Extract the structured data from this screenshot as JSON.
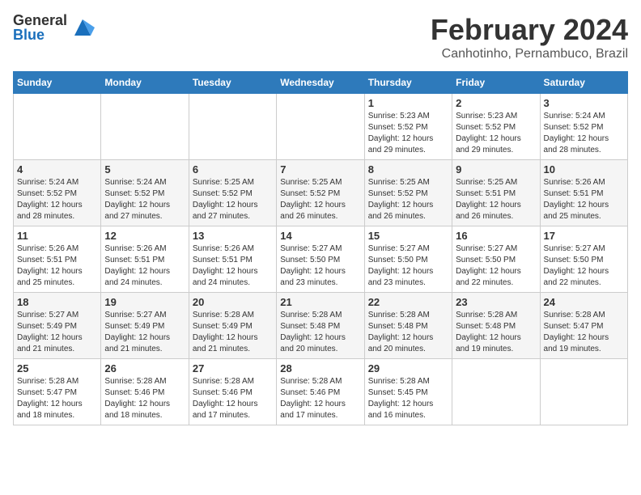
{
  "header": {
    "logo_general": "General",
    "logo_blue": "Blue",
    "month_year": "February 2024",
    "location": "Canhotinho, Pernambuco, Brazil"
  },
  "weekdays": [
    "Sunday",
    "Monday",
    "Tuesday",
    "Wednesday",
    "Thursday",
    "Friday",
    "Saturday"
  ],
  "weeks": [
    [
      {
        "day": "",
        "info": ""
      },
      {
        "day": "",
        "info": ""
      },
      {
        "day": "",
        "info": ""
      },
      {
        "day": "",
        "info": ""
      },
      {
        "day": "1",
        "info": "Sunrise: 5:23 AM\nSunset: 5:52 PM\nDaylight: 12 hours\nand 29 minutes."
      },
      {
        "day": "2",
        "info": "Sunrise: 5:23 AM\nSunset: 5:52 PM\nDaylight: 12 hours\nand 29 minutes."
      },
      {
        "day": "3",
        "info": "Sunrise: 5:24 AM\nSunset: 5:52 PM\nDaylight: 12 hours\nand 28 minutes."
      }
    ],
    [
      {
        "day": "4",
        "info": "Sunrise: 5:24 AM\nSunset: 5:52 PM\nDaylight: 12 hours\nand 28 minutes."
      },
      {
        "day": "5",
        "info": "Sunrise: 5:24 AM\nSunset: 5:52 PM\nDaylight: 12 hours\nand 27 minutes."
      },
      {
        "day": "6",
        "info": "Sunrise: 5:25 AM\nSunset: 5:52 PM\nDaylight: 12 hours\nand 27 minutes."
      },
      {
        "day": "7",
        "info": "Sunrise: 5:25 AM\nSunset: 5:52 PM\nDaylight: 12 hours\nand 26 minutes."
      },
      {
        "day": "8",
        "info": "Sunrise: 5:25 AM\nSunset: 5:52 PM\nDaylight: 12 hours\nand 26 minutes."
      },
      {
        "day": "9",
        "info": "Sunrise: 5:25 AM\nSunset: 5:51 PM\nDaylight: 12 hours\nand 26 minutes."
      },
      {
        "day": "10",
        "info": "Sunrise: 5:26 AM\nSunset: 5:51 PM\nDaylight: 12 hours\nand 25 minutes."
      }
    ],
    [
      {
        "day": "11",
        "info": "Sunrise: 5:26 AM\nSunset: 5:51 PM\nDaylight: 12 hours\nand 25 minutes."
      },
      {
        "day": "12",
        "info": "Sunrise: 5:26 AM\nSunset: 5:51 PM\nDaylight: 12 hours\nand 24 minutes."
      },
      {
        "day": "13",
        "info": "Sunrise: 5:26 AM\nSunset: 5:51 PM\nDaylight: 12 hours\nand 24 minutes."
      },
      {
        "day": "14",
        "info": "Sunrise: 5:27 AM\nSunset: 5:50 PM\nDaylight: 12 hours\nand 23 minutes."
      },
      {
        "day": "15",
        "info": "Sunrise: 5:27 AM\nSunset: 5:50 PM\nDaylight: 12 hours\nand 23 minutes."
      },
      {
        "day": "16",
        "info": "Sunrise: 5:27 AM\nSunset: 5:50 PM\nDaylight: 12 hours\nand 22 minutes."
      },
      {
        "day": "17",
        "info": "Sunrise: 5:27 AM\nSunset: 5:50 PM\nDaylight: 12 hours\nand 22 minutes."
      }
    ],
    [
      {
        "day": "18",
        "info": "Sunrise: 5:27 AM\nSunset: 5:49 PM\nDaylight: 12 hours\nand 21 minutes."
      },
      {
        "day": "19",
        "info": "Sunrise: 5:27 AM\nSunset: 5:49 PM\nDaylight: 12 hours\nand 21 minutes."
      },
      {
        "day": "20",
        "info": "Sunrise: 5:28 AM\nSunset: 5:49 PM\nDaylight: 12 hours\nand 21 minutes."
      },
      {
        "day": "21",
        "info": "Sunrise: 5:28 AM\nSunset: 5:48 PM\nDaylight: 12 hours\nand 20 minutes."
      },
      {
        "day": "22",
        "info": "Sunrise: 5:28 AM\nSunset: 5:48 PM\nDaylight: 12 hours\nand 20 minutes."
      },
      {
        "day": "23",
        "info": "Sunrise: 5:28 AM\nSunset: 5:48 PM\nDaylight: 12 hours\nand 19 minutes."
      },
      {
        "day": "24",
        "info": "Sunrise: 5:28 AM\nSunset: 5:47 PM\nDaylight: 12 hours\nand 19 minutes."
      }
    ],
    [
      {
        "day": "25",
        "info": "Sunrise: 5:28 AM\nSunset: 5:47 PM\nDaylight: 12 hours\nand 18 minutes."
      },
      {
        "day": "26",
        "info": "Sunrise: 5:28 AM\nSunset: 5:46 PM\nDaylight: 12 hours\nand 18 minutes."
      },
      {
        "day": "27",
        "info": "Sunrise: 5:28 AM\nSunset: 5:46 PM\nDaylight: 12 hours\nand 17 minutes."
      },
      {
        "day": "28",
        "info": "Sunrise: 5:28 AM\nSunset: 5:46 PM\nDaylight: 12 hours\nand 17 minutes."
      },
      {
        "day": "29",
        "info": "Sunrise: 5:28 AM\nSunset: 5:45 PM\nDaylight: 12 hours\nand 16 minutes."
      },
      {
        "day": "",
        "info": ""
      },
      {
        "day": "",
        "info": ""
      }
    ]
  ]
}
